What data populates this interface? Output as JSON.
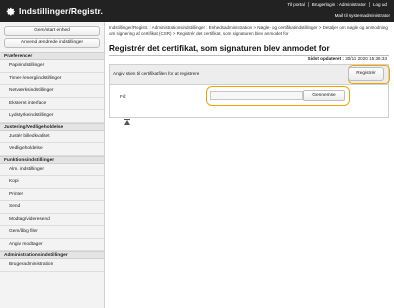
{
  "app": {
    "title": "Indstillinger/Registr.",
    "top_links": [
      "Til portal",
      "Brugerlogin : Administrator",
      "Log ud"
    ],
    "mail_link": "Mail til systemadministrator"
  },
  "sidebar": {
    "buttons": [
      "Gem/start enhed",
      "Anvend ændrede indstillinger"
    ],
    "sections": [
      {
        "title": "Præferencer",
        "items": [
          "Papirindstillinger",
          "Timer-/energiindstillinger",
          "Netværksindstillinger",
          "Eksternt interface",
          "Lydstyrkeindstillinger"
        ]
      },
      {
        "title": "Justering/Vedligeholdelse",
        "items": [
          "Justér billedkvalitet",
          "Vedligeholdelse"
        ]
      },
      {
        "title": "Funktionsindstillinger",
        "items": [
          "Alm. indstillinger",
          "Kopi",
          "Printer",
          "Send",
          "Modtag/videresend",
          "Gem/åbg filer",
          "Angiv modtager"
        ]
      },
      {
        "title": "Administrationsindstillinger",
        "items": [
          "Brugeradministration"
        ]
      }
    ]
  },
  "main": {
    "breadcrumb": "Indstillinger/Registr. : Administrationsindstillinger : Enhedsadministration > Nøgle- og certifikatindstillinger > Detaljer om nøgle og anmodning om signering af certifikat (CSR) > Registrér det certifikat, som signaturen blev anmodet for",
    "page_title": "Registrér det certifikat, som signaturen blev anmodet for",
    "last_updated_label": "Sidst opdateret :",
    "last_updated_value": "30/11 2020 15:36:33",
    "path_label": "Angiv stien til certifikatfilen for at registrere",
    "register_button": "Registrér",
    "file_label": "Fil:",
    "file_value": "",
    "browse_button": "Gennemse"
  },
  "colors": {
    "topbar": "#222222",
    "highlight": "#f0a500"
  }
}
